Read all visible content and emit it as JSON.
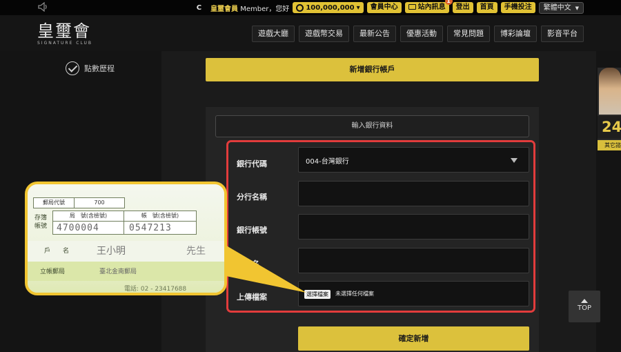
{
  "topbar": {
    "c_letter": "C",
    "member_name": "皇璽會員",
    "greeting": " Member，您好",
    "points": "100,000,000",
    "points_caret": "▾",
    "member_center": "會員中心",
    "inbox": "站內訊息",
    "inbox_badge": "1",
    "logout": "登出",
    "home": "首頁",
    "mobile_bet": "手機投注",
    "language": "繁體中文"
  },
  "header": {
    "logo_main": "皇璽會",
    "logo_sub": "SIGNATURE CLUB",
    "nav": [
      "遊戲大廳",
      "遊戲幣交易",
      "最新公告",
      "優惠活動",
      "常見問題",
      "博彩論壇",
      "影音平台"
    ]
  },
  "sidebar": {
    "points_history": "點數歷程"
  },
  "main": {
    "add_account": "新增銀行帳戶",
    "input_header": "輸入銀行資料",
    "fields": {
      "bank_code_label": "銀行代碼",
      "bank_code_value": "004-台灣銀行",
      "branch_label": "分行名稱",
      "account_label": "銀行帳號",
      "holder_label": "行戶名",
      "upload_label": "上傳檔案",
      "file_button": "選擇檔案",
      "file_status": "未選擇任何檔案"
    },
    "confirm": "確定新增"
  },
  "side_banner": {
    "hours": "24",
    "foot": "其它諮"
  },
  "top_button": "TOP",
  "passbook": {
    "office_code_label": "郵局代號",
    "office_code_value": "700",
    "passbook_label_1": "存簿",
    "passbook_label_2": "帳號",
    "office_no_label": "局　號(含檢號)",
    "account_no_label": "帳　號(含檢號)",
    "office_no": "4700004",
    "account_no": "0547213",
    "holder_label": "戶　　名",
    "holder_name": "王小明",
    "holder_suffix": "先生",
    "branch_label": "立帳郵局",
    "branch_name": "臺北金南郵局",
    "phone": "電話: 02 - 23417688"
  },
  "colors": {
    "accent": "#dcc13c",
    "highlight_border": "#e23c3c",
    "callout_border": "#f1c531"
  }
}
